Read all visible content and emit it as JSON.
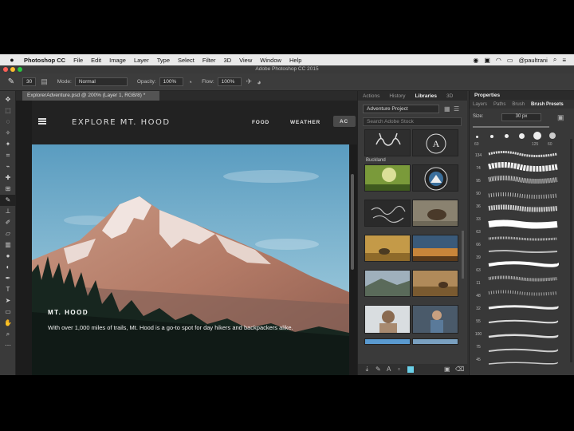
{
  "menubar": {
    "app_name": "Photoshop CC",
    "items": [
      "File",
      "Edit",
      "Image",
      "Layer",
      "Type",
      "Select",
      "Filter",
      "3D",
      "View",
      "Window",
      "Help"
    ],
    "user": "@paultrani"
  },
  "window": {
    "title": "Adobe Photoshop CC 2015"
  },
  "options_bar": {
    "size": "30",
    "mode_label": "Mode:",
    "mode_value": "Normal",
    "opacity_label": "Opacity:",
    "opacity_value": "100%",
    "flow_label": "Flow:",
    "flow_value": "100%"
  },
  "document": {
    "tab_label": "ExplorerAdventure.psd @ 200% (Layer 1, RGB/8) *",
    "site_title": "EXPLORE MT. HOOD",
    "nav": [
      "FOOD",
      "WEATHER",
      "AC"
    ],
    "hero_title": "MT. HOOD",
    "hero_body": "With over 1,000 miles of trails, Mt. Hood is a go-to spot for day hikers and backpackers alike."
  },
  "libraries": {
    "tabs": [
      "Actions",
      "History",
      "Libraries",
      "3D"
    ],
    "active_tab": "Libraries",
    "library": "Adventure Project",
    "search_placeholder": "Search Adobe Stock",
    "first_item_label": "Buckland"
  },
  "properties": {
    "title": "Properties",
    "tabs": [
      "Layers",
      "Paths",
      "Brush",
      "Brush Presets"
    ],
    "active_tab": "Brush Presets",
    "size_label": "Size:",
    "size_value": "30 px",
    "preset_numbers": [
      "60",
      "125",
      "60",
      "134",
      "74",
      "95",
      "90",
      "36",
      "33",
      "63",
      "66",
      "39",
      "63",
      "11",
      "48",
      "32",
      "55",
      "100",
      "75",
      "45",
      "1070",
      "1499",
      "63",
      "50",
      "63",
      "25",
      "50",
      "20"
    ]
  }
}
